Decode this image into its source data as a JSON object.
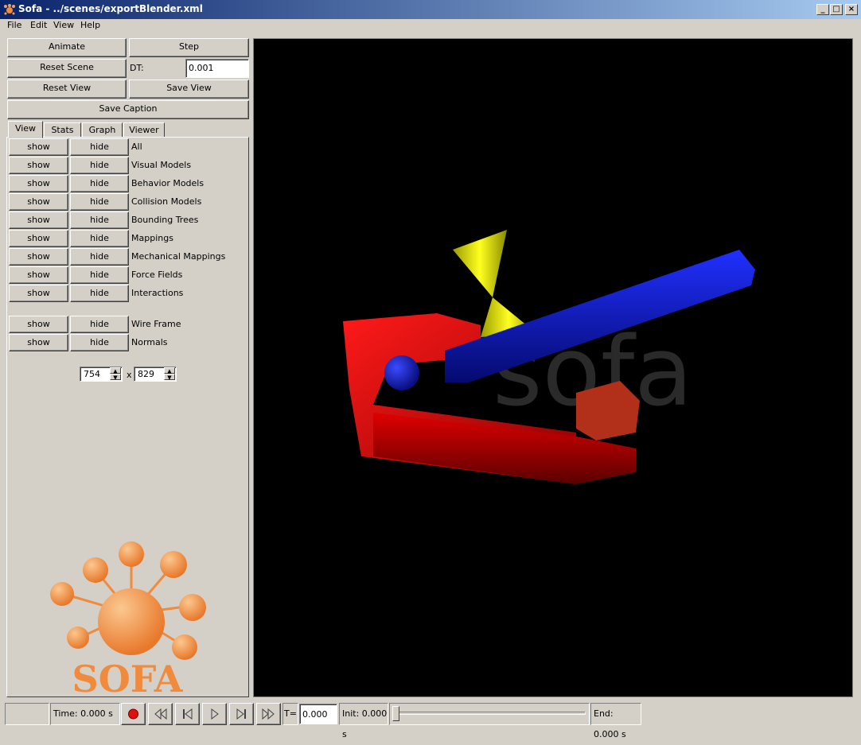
{
  "window": {
    "title": "Sofa - ../scenes/exportBlender.xml",
    "controls": [
      "_",
      "□",
      "×"
    ]
  },
  "menu": [
    "File",
    "Edit",
    "View",
    "Help"
  ],
  "controls": {
    "animate": "Animate",
    "step": "Step",
    "reset_scene": "Reset Scene",
    "dt_label": "DT:",
    "dt_value": "0.001",
    "reset_view": "Reset View",
    "save_view": "Save View",
    "save_caption": "Save Caption"
  },
  "tabs": [
    "View",
    "Stats",
    "Graph",
    "Viewer"
  ],
  "view_rows": [
    {
      "show": "show",
      "hide": "hide",
      "label": "All"
    },
    {
      "show": "show",
      "hide": "hide",
      "label": "Visual Models"
    },
    {
      "show": "show",
      "hide": "hide",
      "label": "Behavior Models"
    },
    {
      "show": "show",
      "hide": "hide",
      "label": "Collision Models"
    },
    {
      "show": "show",
      "hide": "hide",
      "label": "Bounding Trees"
    },
    {
      "show": "show",
      "hide": "hide",
      "label": "Mappings"
    },
    {
      "show": "show",
      "hide": "hide",
      "label": "Mechanical Mappings"
    },
    {
      "show": "show",
      "hide": "hide",
      "label": "Force Fields"
    },
    {
      "show": "show",
      "hide": "hide",
      "label": "Interactions"
    },
    {
      "show": "show",
      "hide": "hide",
      "label": "Wire Frame"
    },
    {
      "show": "show",
      "hide": "hide",
      "label": "Normals"
    }
  ],
  "size": {
    "width": "754",
    "x": "x",
    "height": "829"
  },
  "logo_text": "SOFA",
  "watermark": "sofa",
  "status": {
    "time": "Time: 0.000 s",
    "t_label": "T=",
    "t_value": "0.000",
    "init": "Init: 0.000 s",
    "end": "End: 0.000 s",
    "timeline_fraction": 0
  },
  "colors": {
    "titlebar_start": "#0a246a",
    "face": "#d4d0c8",
    "viewer_bg": "#000000",
    "record": "#e01010",
    "logo": "#f08a3c"
  }
}
